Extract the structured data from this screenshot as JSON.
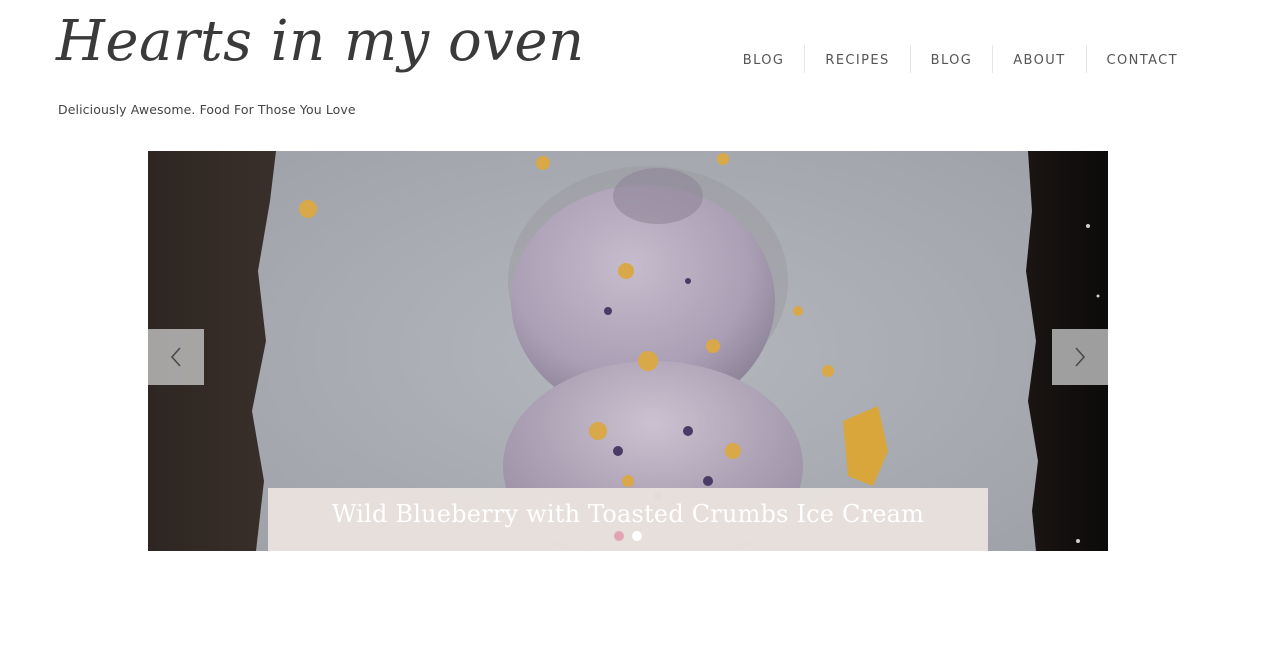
{
  "site": {
    "title": "Hearts in my oven",
    "tagline": "Deliciously Awesome. Food For Those You Love"
  },
  "nav": {
    "items": [
      {
        "label": "BLOG"
      },
      {
        "label": "RECIPES"
      },
      {
        "label": "BLOG"
      },
      {
        "label": "ABOUT"
      },
      {
        "label": "CONTACT"
      }
    ]
  },
  "slider": {
    "image_alt": "Scoops of lavender-colored ice cream with blueberries and toasted crumbs on parchment paper",
    "prev_icon": "chevron-left-icon",
    "next_icon": "chevron-right-icon",
    "caption": "Wild Blueberry with Toasted Crumbs Ice Cream",
    "slide_count": 2,
    "active_slide": 1
  },
  "colors": {
    "dot_active": "#e0a5b4",
    "dot_inactive": "#ffffff",
    "caption_bg": "#e8e1dd",
    "nav_text": "#555555"
  }
}
